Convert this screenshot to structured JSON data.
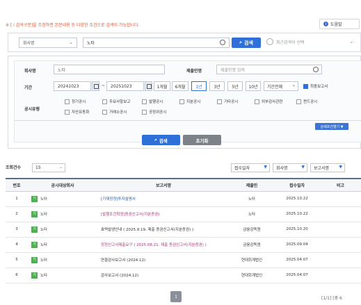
{
  "notice": "※ [ i 검색구분]을 조정하면 본문내용 등 다양한 조건으로 검색이 가능합니다.",
  "help_button": "도움말",
  "search": {
    "category": "회사명",
    "company_value": "노타",
    "search_button": "검색",
    "recent_placeholder": "최근검색어 선택"
  },
  "filters": {
    "company_label": "회사명",
    "company_value": "노타",
    "submitter_label": "제출인명",
    "submitter_placeholder": "제출인명 입력",
    "period_label": "기간",
    "start_date": "20241023",
    "date_sep": "~",
    "end_date": "20251023",
    "period_buttons": [
      "1개월",
      "6개월",
      "1년",
      "3년",
      "5년",
      "10년"
    ],
    "active_period": "1년",
    "all_period": "기간전체",
    "latest_report_label": "최종보고서",
    "disclosure_type_label": "공시유형",
    "types": [
      "정기공시",
      "주요사항보고",
      "발행공시",
      "지분공시",
      "기타공시",
      "외부감사관련",
      "펀드공시",
      "자산유동화",
      "거래소공시",
      "공정위공시"
    ],
    "detail_button": "상세조건열기 ▼",
    "search_button": "검색",
    "reset_button": "초기화"
  },
  "results": {
    "count_label": "조회건수",
    "count_value": "15",
    "sort_options": [
      "접수일자",
      "회사명",
      "보고서명"
    ],
    "columns": [
      "번호",
      "공시대상회사",
      "보고서명",
      "제출인",
      "접수일자",
      "비고"
    ],
    "rows": [
      {
        "no": "1",
        "badge": "기",
        "company": "노타",
        "report": "[기재정정]투자설명서",
        "submitter": "노타",
        "date": "2025.10.22",
        "note": "",
        "style": "blue"
      },
      {
        "no": "2",
        "badge": "기",
        "company": "노타",
        "report": "[발행조건확정]증권신고서(지분증권)",
        "submitter": "노타",
        "date": "2025.10.22",
        "note": "",
        "style": "pink"
      },
      {
        "no": "3",
        "badge": "기",
        "company": "노타",
        "report": "효력발생안내 ( 2025.9.19. 제출 증권신고서(지분증권) )",
        "submitter": "금융감독원",
        "date": "2025.10.20",
        "note": "",
        "style": "plain"
      },
      {
        "no": "4",
        "badge": "기",
        "company": "노타",
        "report": "정정신고서제출요구 ( 2025.08.21. 제출 증권신고서(지분증권) )",
        "submitter": "금융감독원",
        "date": "2025.09.04",
        "note": "",
        "style": "pink"
      },
      {
        "no": "5",
        "badge": "기",
        "company": "노타",
        "report": "연결감사보고서 (2024.12)",
        "submitter": "현대회계법인",
        "date": "2025.04.07",
        "note": "",
        "style": "plain"
      },
      {
        "no": "6",
        "badge": "기",
        "company": "노타",
        "report": "감사보고서 (2024.12)",
        "submitter": "현대회계법인",
        "date": "2025.04.07",
        "note": "",
        "style": "plain"
      }
    ],
    "page_current": "1",
    "page_info": "[1/1] [총 6"
  },
  "colors": {
    "primary": "#2e6fd8",
    "badge": "#4caf50",
    "notice": "#e4572e"
  }
}
